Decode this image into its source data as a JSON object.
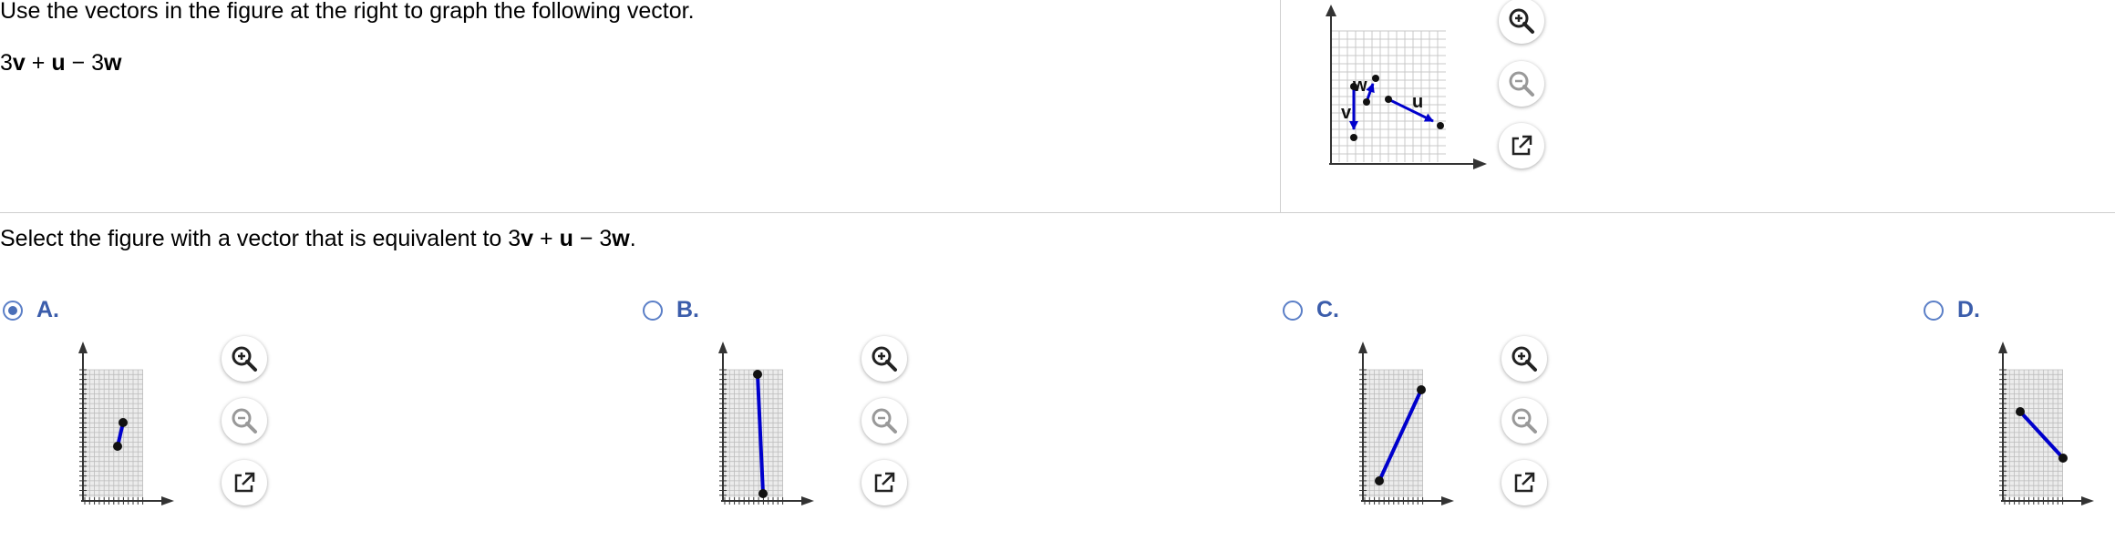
{
  "question": {
    "instruction": "Use the vectors in the figure at the right to graph the following vector.",
    "expression_parts": [
      "3",
      "v",
      " + ",
      "u",
      " − 3",
      "w"
    ],
    "prompt_parts": [
      "Select the figure with a vector that is equivalent to 3",
      "v",
      " + ",
      "u",
      " − 3",
      "w",
      "."
    ]
  },
  "reference_graph": {
    "vector_labels": [
      "w",
      "v",
      "u"
    ],
    "vector_color": "#0000cc"
  },
  "zoom_icons": [
    "zoom-in-icon",
    "zoom-out-icon",
    "external-link-icon"
  ],
  "options": [
    {
      "id": "A",
      "label": "A.",
      "selected": true
    },
    {
      "id": "B",
      "label": "B.",
      "selected": false
    },
    {
      "id": "C",
      "label": "C.",
      "selected": false
    },
    {
      "id": "D",
      "label": "D.",
      "selected": false
    }
  ],
  "colors": {
    "accent": "#3b5dab",
    "vector": "#0000cc",
    "grid": "#c8c8c8",
    "divider": "#cfcfcf"
  }
}
